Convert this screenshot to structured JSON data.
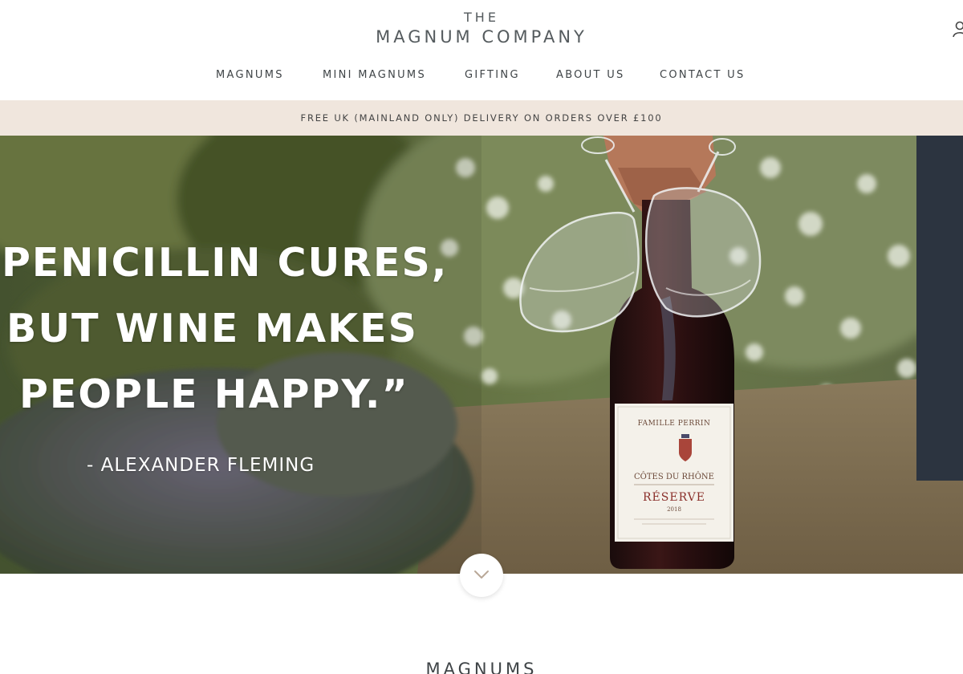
{
  "logo": {
    "line1": "THE",
    "line2": "MAGNUM COMPANY"
  },
  "header": {
    "account_icon": "user-icon"
  },
  "nav": {
    "items": [
      {
        "label": "MAGNUMS"
      },
      {
        "label": "MINI MAGNUMS"
      },
      {
        "label": "GIFTING"
      },
      {
        "label": "ABOUT US"
      },
      {
        "label": "CONTACT US"
      }
    ]
  },
  "announcement": {
    "text": "FREE UK (MAINLAND ONLY) DELIVERY ON ORDERS OVER £100"
  },
  "hero": {
    "quote_lines": [
      "PENICILLIN CURES,",
      "BUT WINE MAKES",
      "PEOPLE HAPPY.”"
    ],
    "attribution": "- ALEXANDER FLEMING",
    "bottle_label": {
      "producer": "FAMILLE PERRIN",
      "appellation": "CÔTES DU RHÔNE",
      "cuvee": "RÉSERVE",
      "vintage": "2018"
    },
    "scroll_icon": "chevron-down-icon"
  },
  "section": {
    "title": "MAGNUMS"
  },
  "colors": {
    "announcement_bg": "#f0e6dd",
    "logo_text": "#555b5e",
    "nav_text": "#3f4447"
  }
}
